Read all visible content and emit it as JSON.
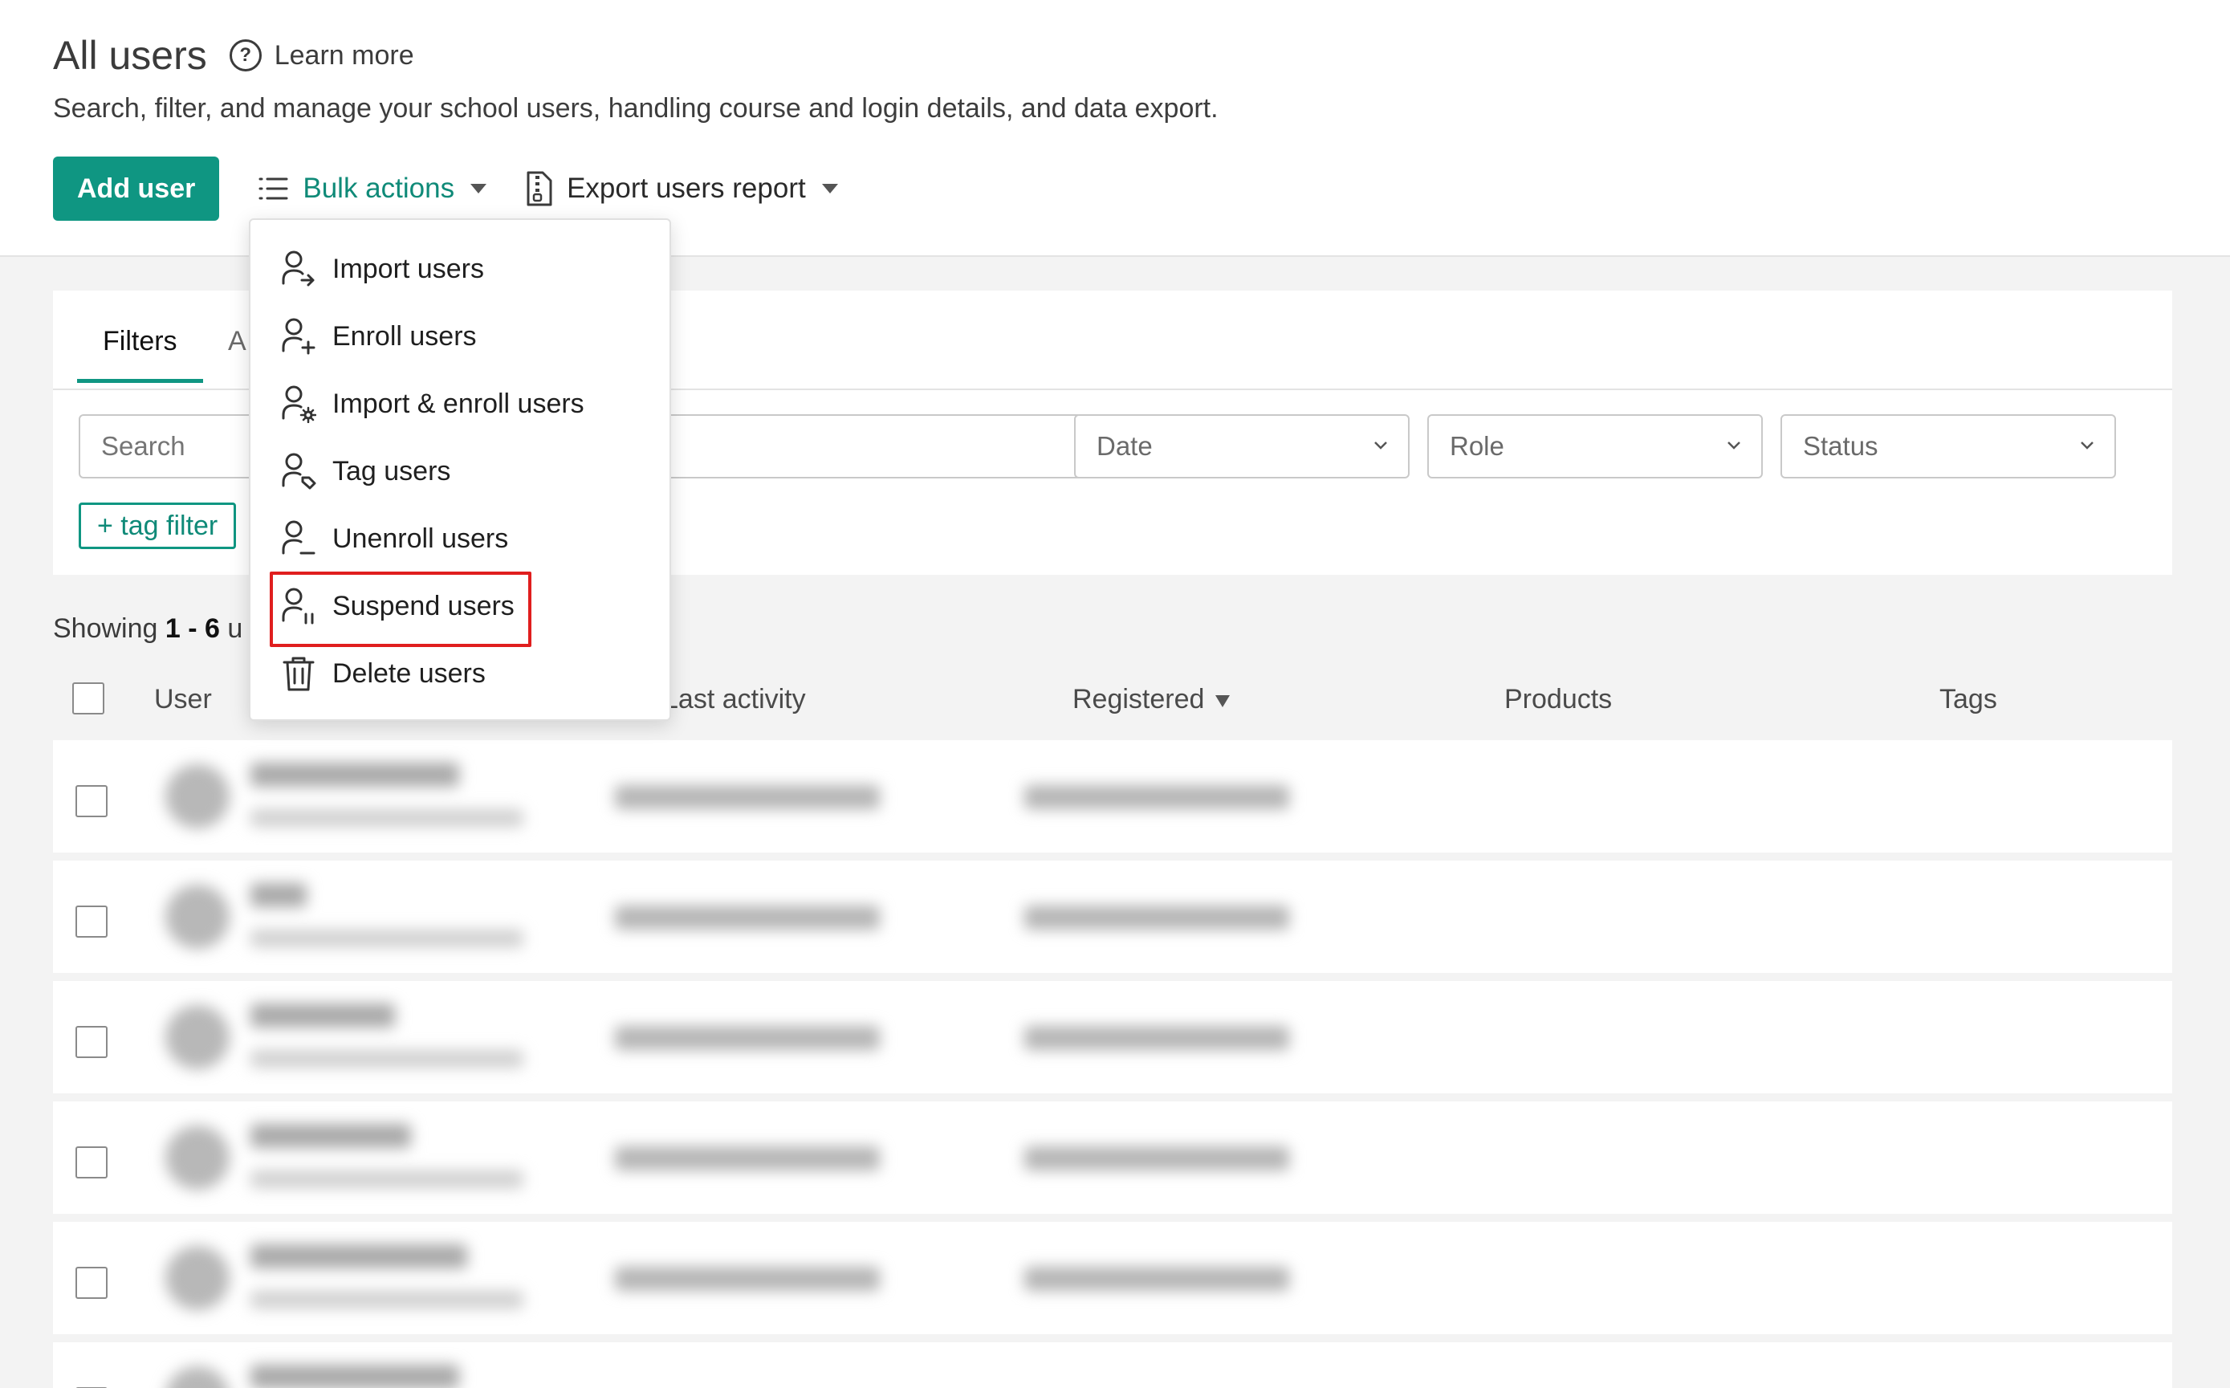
{
  "header": {
    "title": "All users",
    "learn_more": "Learn more",
    "subtitle": "Search, filter, and manage your school users, handling course and login details, and data export.",
    "add_user_label": "Add user",
    "bulk_actions_label": "Bulk actions",
    "export_label": "Export users report"
  },
  "filters": {
    "tabs": [
      {
        "label": "Filters"
      },
      {
        "label": "A"
      }
    ],
    "search_placeholder": "Search",
    "selects": [
      {
        "label": ""
      },
      {
        "label": "Date"
      },
      {
        "label": "Role"
      },
      {
        "label": "Status"
      }
    ],
    "tag_filter_label": "+ tag filter"
  },
  "showing": {
    "prefix": "Showing ",
    "range": "1 - 6",
    "suffix": " u"
  },
  "table": {
    "columns": {
      "user": "User",
      "last_activity": "Last activity",
      "registered": "Registered",
      "products": "Products",
      "tags": "Tags"
    }
  },
  "bulk_menu": {
    "items": [
      {
        "label": "Import users",
        "icon": "user-import-icon"
      },
      {
        "label": "Enroll users",
        "icon": "user-add-icon"
      },
      {
        "label": "Import & enroll users",
        "icon": "user-gear-icon"
      },
      {
        "label": "Tag users",
        "icon": "user-tag-icon"
      },
      {
        "label": "Unenroll users",
        "icon": "user-remove-icon"
      },
      {
        "label": "Suspend users",
        "icon": "user-pause-icon"
      },
      {
        "label": "Delete users",
        "icon": "trash-icon"
      }
    ]
  },
  "colors": {
    "accent": "#0f9682",
    "highlight": "#e01e1e"
  }
}
